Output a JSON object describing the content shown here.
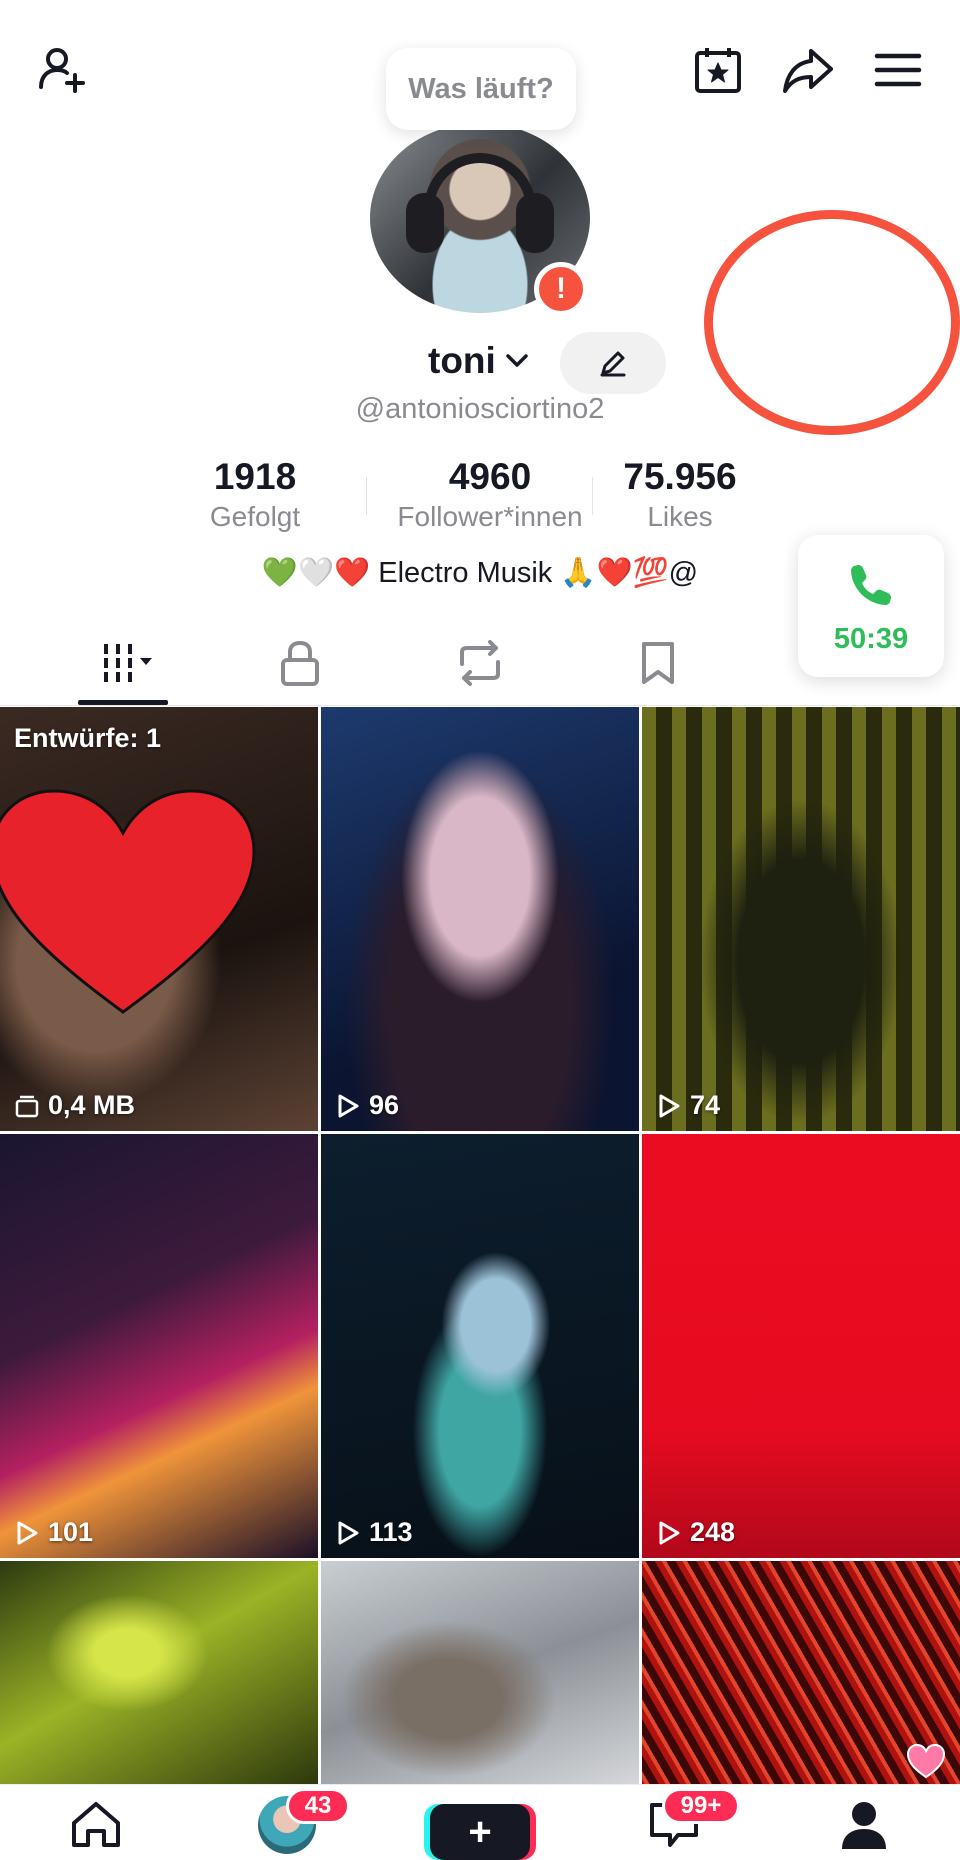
{
  "header": {
    "add_friend_icon": "person-plus-icon",
    "calendar_icon": "calendar-star-icon",
    "share_icon": "share-arrow-icon",
    "menu_icon": "hamburger-menu-icon"
  },
  "profile": {
    "status_bubble": "Was läuft?",
    "alert_badge": "!",
    "display_name": "toni",
    "handle": "@antoniosciortino2",
    "bio": "💚🤍❤️ Electro Musik 🙏❤️💯@",
    "ring_color": "#f5533d"
  },
  "stats": [
    {
      "value": "1918",
      "label": "Gefolgt"
    },
    {
      "value": "4960",
      "label": "Follower*innen"
    },
    {
      "value": "75.956",
      "label": "Likes"
    }
  ],
  "call": {
    "time": "50:39",
    "color": "#2ebd59"
  },
  "tabs": [
    {
      "name": "videos",
      "icon": "grid-bars-icon",
      "active": true
    },
    {
      "name": "private",
      "icon": "lock-icon"
    },
    {
      "name": "reposts",
      "icon": "repost-icon"
    },
    {
      "name": "saved",
      "icon": "bookmark-icon"
    }
  ],
  "grid": [
    {
      "type": "draft",
      "label": "Entwürfe: 1",
      "meta": "0,4 MB"
    },
    {
      "views": "96"
    },
    {
      "views": "74"
    },
    {
      "views": "101"
    },
    {
      "views": "113"
    },
    {
      "views": "248"
    },
    {
      "views": ""
    },
    {
      "views": ""
    },
    {
      "views": ""
    }
  ],
  "bottom_nav": {
    "inbox_badge": "43",
    "messages_badge": "99+",
    "accent": "#fe2c55"
  }
}
